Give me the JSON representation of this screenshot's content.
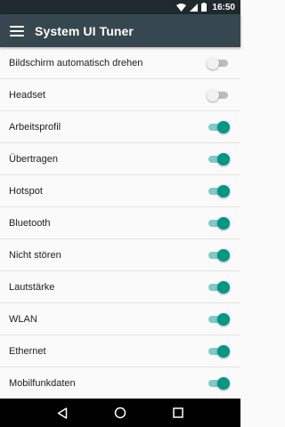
{
  "status_bar": {
    "time": "16:50",
    "icons": [
      "wifi-icon",
      "signal-icon",
      "battery-icon"
    ]
  },
  "toolbar": {
    "title": "System UI Tuner",
    "menu_icon": "hamburger-menu-icon"
  },
  "items": [
    {
      "label": "Bildschirm automatisch drehen",
      "enabled": false
    },
    {
      "label": "Headset",
      "enabled": false
    },
    {
      "label": "Arbeitsprofil",
      "enabled": true
    },
    {
      "label": "Übertragen",
      "enabled": true
    },
    {
      "label": "Hotspot",
      "enabled": true
    },
    {
      "label": "Bluetooth",
      "enabled": true
    },
    {
      "label": "Nicht stören",
      "enabled": true
    },
    {
      "label": "Lautstärke",
      "enabled": true
    },
    {
      "label": "WLAN",
      "enabled": true
    },
    {
      "label": "Ethernet",
      "enabled": true
    },
    {
      "label": "Mobilfunkdaten",
      "enabled": true
    }
  ],
  "nav_bar": {
    "buttons": [
      "back-icon",
      "home-icon",
      "recents-icon"
    ]
  },
  "colors": {
    "toolbar": "#37474f",
    "status_bar": "#1f2a2f",
    "accent": "#009688",
    "accent_track": "#80cbc4"
  }
}
